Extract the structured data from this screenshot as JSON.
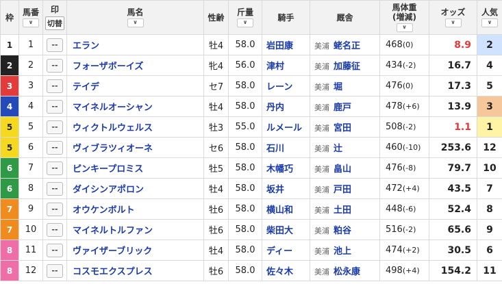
{
  "header": {
    "waku": "枠",
    "umaban": "馬番",
    "mark": "印",
    "toggle": "切替",
    "horse": "馬名",
    "sexage": "性齢",
    "weight": "斤量",
    "jockey": "騎手",
    "stable": "厩舎",
    "bodyweight": "馬体重",
    "bodyweight_sub": "(増減)",
    "odds": "オッズ",
    "popularity": "人気",
    "sort_glyph": "∨",
    "mark_glyph": "--"
  },
  "colors": {
    "waku1": "#ffffff",
    "waku2": "#222222",
    "waku3": "#e33a3a",
    "waku4": "#2449b8",
    "waku5": "#f4d91f",
    "waku6": "#2e9a45",
    "waku7": "#f08c1e",
    "waku8": "#f06ea8",
    "pop1": "#fff4a6",
    "pop2": "#cfe2ff",
    "pop3": "#f5c79a",
    "hot_odds": "#e13b3b"
  },
  "rows": [
    {
      "waku": "1",
      "umaban": "1",
      "horse": "エラン",
      "sexage": "牡4",
      "weight": "58.0",
      "jockey": "岩田康",
      "region": "美浦",
      "trainer": "蛯名正",
      "body": "468",
      "diff": "(0)",
      "odds": "8.9",
      "pop": "2"
    },
    {
      "waku": "2",
      "umaban": "2",
      "horse": "フォーザボーイズ",
      "sexage": "牝4",
      "weight": "56.0",
      "jockey": "津村",
      "region": "美浦",
      "trainer": "加藤征",
      "body": "434",
      "diff": "(-2)",
      "odds": "16.7",
      "pop": "4"
    },
    {
      "waku": "3",
      "umaban": "3",
      "horse": "テイデ",
      "sexage": "セ7",
      "weight": "58.0",
      "jockey": "レーン",
      "region": "美浦",
      "trainer": "堀",
      "body": "476",
      "diff": "(0)",
      "odds": "17.3",
      "pop": "5"
    },
    {
      "waku": "4",
      "umaban": "4",
      "horse": "マイネルオーシャン",
      "sexage": "牡4",
      "weight": "58.0",
      "jockey": "丹内",
      "region": "美浦",
      "trainer": "鹿戸",
      "body": "478",
      "diff": "(+6)",
      "odds": "13.9",
      "pop": "3"
    },
    {
      "waku": "5",
      "umaban": "5",
      "horse": "ウィクトルウェルス",
      "sexage": "牡3",
      "weight": "55.0",
      "jockey": "ルメール",
      "region": "美浦",
      "trainer": "宮田",
      "body": "508",
      "diff": "(-2)",
      "odds": "1.1",
      "pop": "1"
    },
    {
      "waku": "5",
      "umaban": "6",
      "horse": "ヴィブラツィオーネ",
      "sexage": "セ6",
      "weight": "58.0",
      "jockey": "石川",
      "region": "美浦",
      "trainer": "辻",
      "body": "460",
      "diff": "(-10)",
      "odds": "253.6",
      "pop": "12"
    },
    {
      "waku": "6",
      "umaban": "7",
      "horse": "ピンキープロミス",
      "sexage": "牡5",
      "weight": "58.0",
      "jockey": "木幡巧",
      "region": "美浦",
      "trainer": "畠山",
      "body": "476",
      "diff": "(-8)",
      "odds": "79.7",
      "pop": "10"
    },
    {
      "waku": "6",
      "umaban": "8",
      "horse": "ダイシンアポロン",
      "sexage": "牡4",
      "weight": "58.0",
      "jockey": "坂井",
      "region": "美浦",
      "trainer": "戸田",
      "body": "472",
      "diff": "(+4)",
      "odds": "43.5",
      "pop": "7"
    },
    {
      "waku": "7",
      "umaban": "9",
      "horse": "オウケンボルト",
      "sexage": "牡6",
      "weight": "58.0",
      "jockey": "横山和",
      "region": "美浦",
      "trainer": "土田",
      "body": "448",
      "diff": "(-6)",
      "odds": "52.4",
      "pop": "8"
    },
    {
      "waku": "7",
      "umaban": "10",
      "horse": "マイネルトルファン",
      "sexage": "牡6",
      "weight": "58.0",
      "jockey": "柴田大",
      "region": "美浦",
      "trainer": "粕谷",
      "body": "516",
      "diff": "(-2)",
      "odds": "65.6",
      "pop": "9"
    },
    {
      "waku": "8",
      "umaban": "11",
      "horse": "ヴァイザーブリック",
      "sexage": "牡4",
      "weight": "58.0",
      "jockey": "ディー",
      "region": "美浦",
      "trainer": "池上",
      "body": "474",
      "diff": "(+2)",
      "odds": "30.5",
      "pop": "6"
    },
    {
      "waku": "8",
      "umaban": "12",
      "horse": "コスモエクスプレス",
      "sexage": "牡6",
      "weight": "58.0",
      "jockey": "佐々木",
      "region": "美浦",
      "trainer": "松永康",
      "body": "498",
      "diff": "(+4)",
      "odds": "154.2",
      "pop": "11"
    }
  ]
}
